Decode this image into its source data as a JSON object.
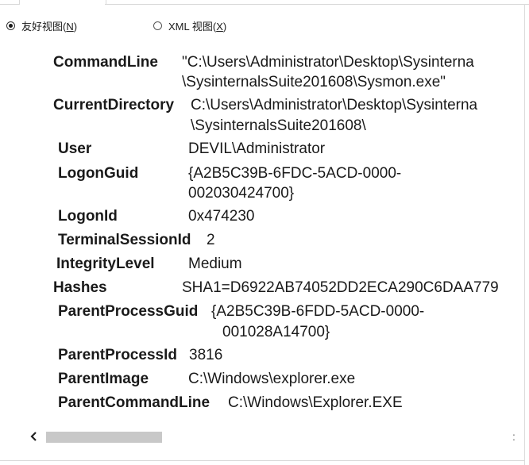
{
  "view_options": {
    "friendly": {
      "label": "友好视图(",
      "mnemonic": "N",
      "suffix": ")",
      "selected": true
    },
    "xml": {
      "label": "XML 视图(",
      "mnemonic": "X",
      "suffix": ")",
      "selected": false
    }
  },
  "details": [
    {
      "key": "CommandLine",
      "lines": [
        "\"C:\\Users\\Administrator\\Desktop\\Sysinterna",
        "\\SysinternalsSuite201608\\Sysmon.exe\""
      ]
    },
    {
      "key": "CurrentDirectory",
      "lines": [
        "C:\\Users\\Administrator\\Desktop\\Sysinterna",
        "\\SysinternalsSuite201608\\"
      ]
    },
    {
      "key": "User",
      "lines": [
        "DEVIL\\Administrator"
      ]
    },
    {
      "key": "LogonGuid",
      "lines": [
        "{A2B5C39B-6FDC-5ACD-0000-",
        "002030424700}"
      ]
    },
    {
      "key": "LogonId",
      "lines": [
        "0x474230"
      ]
    },
    {
      "key": "TerminalSessionId",
      "lines": [
        "2"
      ]
    },
    {
      "key": "IntegrityLevel",
      "lines": [
        "Medium"
      ]
    },
    {
      "key": "Hashes",
      "lines": [
        "SHA1=D6922AB74052DD2ECA290C6DAA779"
      ]
    },
    {
      "key": "ParentProcessGuid",
      "lines": [
        "{A2B5C39B-6FDD-5ACD-0000-",
        "001028A14700}"
      ]
    },
    {
      "key": "ParentProcessId",
      "lines": [
        "3816"
      ]
    },
    {
      "key": "ParentImage",
      "lines": [
        "C:\\Windows\\explorer.exe"
      ]
    },
    {
      "key": "ParentCommandLine",
      "lines": [
        "C:\\Windows\\Explorer.EXE"
      ]
    }
  ],
  "scrollbar": {
    "position": 0.0
  }
}
